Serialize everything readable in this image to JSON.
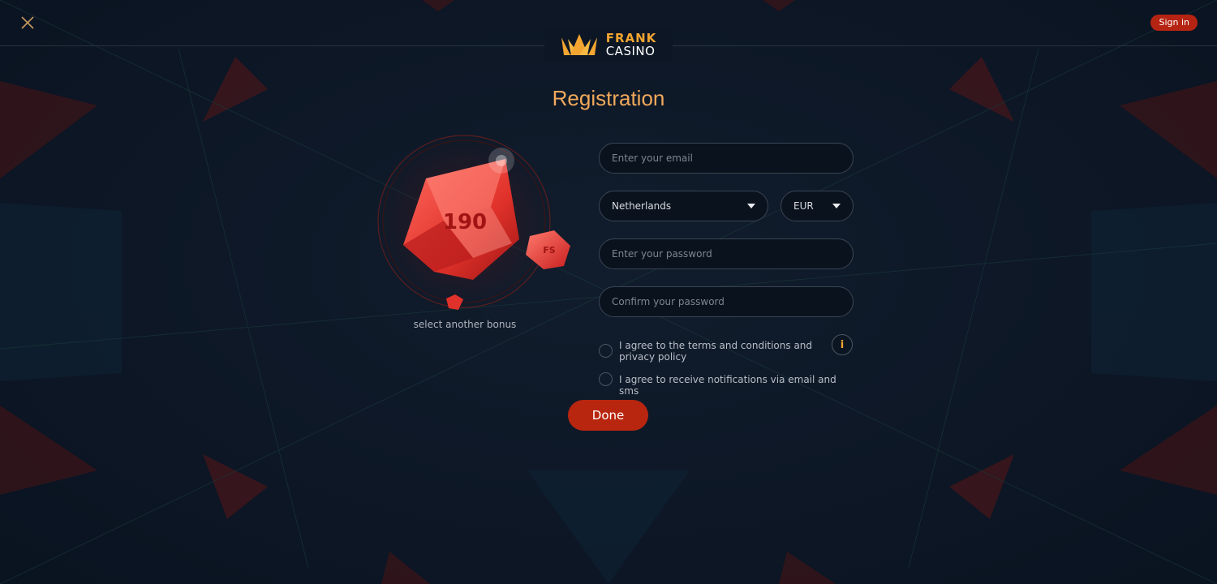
{
  "header": {
    "close_icon": "close-icon",
    "signin_label": "Sign in",
    "logo_line1": "FRANK",
    "logo_line2": "CASINO",
    "logo_icon": "crown-icon"
  },
  "page": {
    "title": "Registration"
  },
  "bonus": {
    "amount": "190",
    "badge": "FS",
    "caption": "select another bonus"
  },
  "form": {
    "email_placeholder": "Enter your email",
    "country_value": "Netherlands",
    "currency_value": "EUR",
    "password_placeholder": "Enter your password",
    "confirm_placeholder": "Confirm your password",
    "terms_label": "I agree to the terms and conditions and privacy policy",
    "notifications_label": "I agree to receive notifications via email and sms",
    "info_glyph": "i",
    "done_label": "Done"
  },
  "colors": {
    "accent": "#b8260f",
    "title": "#f1a95b",
    "logo_gold": "#f3a531",
    "background": "#0c1624"
  }
}
